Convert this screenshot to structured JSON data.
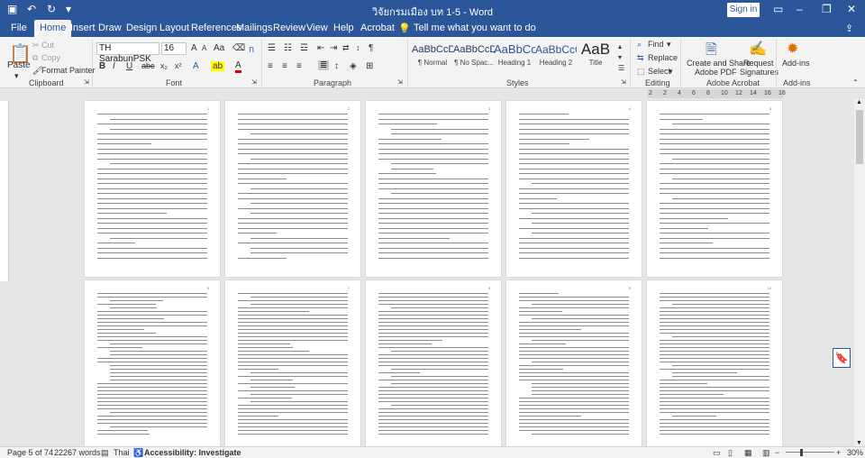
{
  "titlebar": {
    "document_title": "วิจัยกรมเมือง บท 1-5  -  Word",
    "sign_in": "Sign in",
    "quick_access": [
      "save-icon",
      "undo-icon",
      "redo-icon",
      "customize-icon"
    ]
  },
  "tabs": [
    "File",
    "Home",
    "Insert",
    "Draw",
    "Design",
    "Layout",
    "References",
    "Mailings",
    "Review",
    "View",
    "Help",
    "Acrobat"
  ],
  "active_tab": "Home",
  "tell_me": "Tell me what you want to do",
  "clipboard": {
    "paste": "Paste",
    "cut": "Cut",
    "copy": "Copy",
    "format_painter": "Format Painter",
    "group": "Clipboard"
  },
  "font": {
    "name": "TH SarabunPSK",
    "size": "16",
    "bold": "B",
    "italic": "I",
    "underline": "U",
    "strike": "abc",
    "subscript": "x₂",
    "superscript": "x²",
    "grow": "A",
    "shrink": "A",
    "case": "Aa",
    "font_color_label": "A",
    "group": "Font"
  },
  "paragraph": {
    "group": "Paragraph"
  },
  "styles": {
    "items": [
      {
        "sample": "AaBbCcDd",
        "name": "¶ Normal"
      },
      {
        "sample": "AaBbCcDd",
        "name": "¶ No Spac..."
      },
      {
        "sample": "AaBbCc",
        "name": "Heading 1"
      },
      {
        "sample": "AaBbCcC",
        "name": "Heading 2"
      },
      {
        "sample": "AaB",
        "name": "Title"
      }
    ],
    "group": "Styles"
  },
  "editing": {
    "find": "Find",
    "replace": "Replace",
    "select": "Select",
    "group": "Editing"
  },
  "acrobat": {
    "create_share": "Create and Share",
    "adobe_pdf": "Adobe PDF",
    "request": "Request",
    "signatures": "Signatures",
    "group": "Adobe Acrobat"
  },
  "addins": {
    "label": "Add-ins",
    "group": "Add-ins"
  },
  "ruler": {
    "labels": [
      "2",
      "2",
      "4",
      "6",
      "8",
      "10",
      "12",
      "14",
      "16",
      "18"
    ]
  },
  "pages": {
    "row1_numbers": [
      "1",
      "2",
      "3",
      "4",
      "5"
    ],
    "row2_numbers": [
      "6",
      "7",
      "8",
      "9",
      "10"
    ]
  },
  "statusbar": {
    "page": "Page 5 of 74",
    "words": "22267 words",
    "language": "Thai",
    "accessibility": "Accessibility: Investigate",
    "zoom": "30%"
  }
}
